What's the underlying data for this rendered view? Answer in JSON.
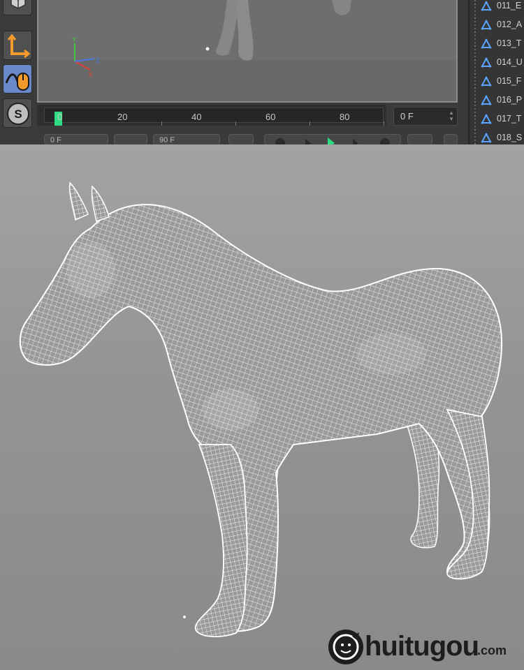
{
  "toolbar": {
    "tools": [
      {
        "icon": "cube-icon"
      },
      {
        "icon": "axis-tool-icon"
      },
      {
        "icon": "mouse-tweak-icon"
      },
      {
        "icon": "snap-icon",
        "label": "S"
      }
    ]
  },
  "viewport": {
    "axis": {
      "y": "Y",
      "z": "Z",
      "x": "X"
    }
  },
  "timeline": {
    "ticks": [
      "0",
      "20",
      "40",
      "60",
      "80"
    ],
    "current_frame": "0 F"
  },
  "bottom_controls": {
    "start_frame": "0 F",
    "end_frame": "90 F"
  },
  "object_list": {
    "items": [
      {
        "label": "011_E"
      },
      {
        "label": "012_A"
      },
      {
        "label": "013_T"
      },
      {
        "label": "014_U"
      },
      {
        "label": "015_F"
      },
      {
        "label": "016_P"
      },
      {
        "label": "017_T"
      },
      {
        "label": "018_S"
      }
    ]
  },
  "watermark": {
    "brand": "huitugou",
    "suffix": ".com"
  },
  "colors": {
    "accent_active": "#6b89c9",
    "timeline_cursor": "#2fdc83",
    "axis_y": "#3fc53f",
    "axis_x": "#e0413a",
    "axis_z": "#4a78e8",
    "object_icon": "#5aa3ff"
  }
}
